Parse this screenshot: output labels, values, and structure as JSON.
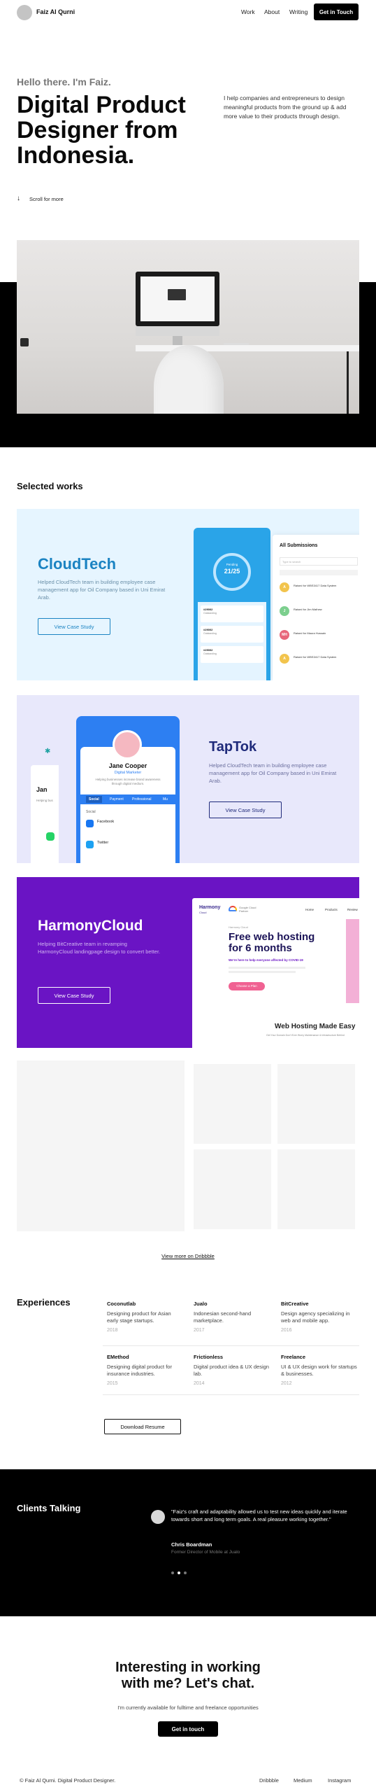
{
  "header": {
    "name": "Faiz Al Qurni",
    "nav": [
      "Work",
      "About",
      "Writing"
    ],
    "cta": "Get in Touch"
  },
  "hero": {
    "greeting": "Hello there. I'm Faiz.",
    "headline_lines": [
      "Digital Product",
      "Designer from",
      "Indonesia."
    ],
    "intro": "I help companies and entrepreneurs to design meaningful products from the ground up & add more value to their products through design.",
    "scroll": "Scroll for more"
  },
  "works": {
    "title": "Selected works",
    "items": [
      {
        "name": "CloudTech",
        "desc": "Helped CloudTech team in building employee case management app for Oil Company based in Uni Emirat Arab.",
        "cta": "View Case Study",
        "bg": "#e6f5ff",
        "accent": "#1b83c2"
      },
      {
        "name": "TapTok",
        "desc": "Helped CloudTech team in building employee case management app for Oil Company based in Uni Emirat Arab.",
        "cta": "View Case Study",
        "bg": "#e8e8fb",
        "accent": "#1f2a7a"
      },
      {
        "name": "HarmonyCloud",
        "desc": "Helping BitCreative team in revamping HarmonyCloud landingpage design to convert better.",
        "cta": "View Case Study",
        "bg": "#6a14c4",
        "accent": "#ffffff"
      }
    ]
  },
  "cloudtech_mock": {
    "app_title": "All Submissions",
    "search": "Type to search",
    "stat_label": "Pending",
    "stat_value": "21/25",
    "tiles": [
      {
        "id": "#29002",
        "sub": "Outstanding"
      },
      {
        "id": "#29002",
        "sub": "Outstanding"
      },
      {
        "id": "#29002",
        "sub": "Outstanding"
      }
    ],
    "rows": [
      {
        "initial": "A",
        "title": "Raised for WBS3417 Data System",
        "color": "#f2c44d"
      },
      {
        "initial": "J",
        "title": "Raised for Jim Mathew",
        "color": "#7ccf8e"
      },
      {
        "initial": "MH",
        "title": "Raised for Maura Hussain",
        "color": "#e8667a"
      },
      {
        "initial": "A",
        "title": "Raised for WBS3417 Data System",
        "color": "#f2c44d"
      }
    ]
  },
  "taptok_mock": {
    "profile_name": "Jane Cooper",
    "profile_role": "Digital Marketer",
    "profile_bio": "Helping businesses increase brand awareness through digital medium.",
    "tabs": [
      "Social",
      "Payment",
      "Professional",
      "Mu"
    ],
    "section": "Social",
    "links": [
      "Facebook",
      "Twitter"
    ],
    "partial": "Jan",
    "partial_sub": "Helping bus"
  },
  "harmony_mock": {
    "brand": "Harmony",
    "brand_sub": "Cloud",
    "partner": "Google Cloud Partner",
    "nav": [
      "Home",
      "Products",
      "Review"
    ],
    "badge": "Harmony Cloud",
    "headline_lines": [
      "Free web hosting",
      "for 6 months"
    ],
    "sub": "We're here to help everyone affected by COVID-19",
    "cta": "Choose a Plan",
    "caption": "Web Hosting Made Easy",
    "caption_sub": "Get Your Domain Don't Ever Worry Maintenance & Infrastructure Behind"
  },
  "dribbble": {
    "link": "View more on Dribbble"
  },
  "experiences": {
    "title": "Experiences",
    "items": [
      {
        "company": "Coconutlab",
        "desc": "Designing product for Asian early stage startups.",
        "year": "2018"
      },
      {
        "company": "Jualo",
        "desc": "Indonesian second-hand marketplace.",
        "year": "2017"
      },
      {
        "company": "BitCreative",
        "desc": "Design agency specializing in web and mobile app.",
        "year": "2016"
      },
      {
        "company": "EMethod",
        "desc": "Designing digital product for insurance industries.",
        "year": "2015"
      },
      {
        "company": "Frictionless",
        "desc": "Digital product idea & UX design lab.",
        "year": "2014"
      },
      {
        "company": "Freelance",
        "desc": "UI & UX design work for startups & businesses.",
        "year": "2012"
      }
    ],
    "resume": "Download Resume"
  },
  "clients": {
    "title": "Clients Talking",
    "quote": "\"Faiz's craft and adaptability allowed us to test new ideas quickly and iterate towards short and long term goals. A real pleasure working together.\"",
    "author": "Chris Boardman",
    "role": "Former Director of Mobile at Jualo"
  },
  "contact": {
    "headline_lines": [
      "Interesting in working",
      "with me? Let's chat."
    ],
    "sub": "I'm currently available for fulltime and freelance opportunities",
    "cta": "Get in touch"
  },
  "footer": {
    "copy": "© Faiz Al Qurni. Digital Product Designer.",
    "links": [
      "Dribbble",
      "Medium",
      "Instagram"
    ]
  }
}
